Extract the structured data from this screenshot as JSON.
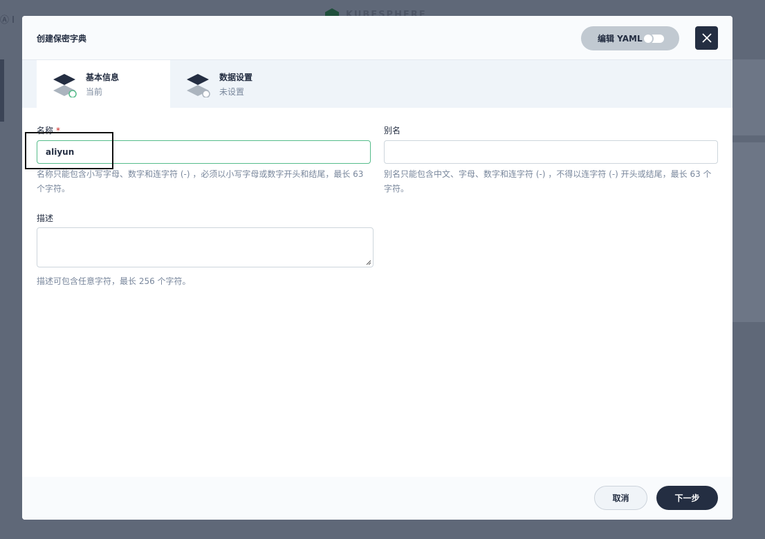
{
  "background": {
    "topleft_text": "Ⓐ I",
    "logo_text": "KUBESPHERE"
  },
  "modal": {
    "title": "创建保密字典",
    "edit_yaml_label": "编辑 YAML",
    "close_icon": "close-icon"
  },
  "steps": [
    {
      "title": "基本信息",
      "status": "当前"
    },
    {
      "title": "数据设置",
      "status": "未设置"
    }
  ],
  "form": {
    "name": {
      "label": "名称",
      "required_mark": "*",
      "value": "aliyun",
      "hint": "名称只能包含小写字母、数字和连字符 (-) ，必须以小写字母或数字开头和结尾，最长 63 个字符。"
    },
    "alias": {
      "label": "别名",
      "value": "",
      "hint": "别名只能包含中文、字母、数字和连字符 (-) ，不得以连字符 (-) 开头或结尾，最长 63 个字符。"
    },
    "description": {
      "label": "描述",
      "value": "",
      "hint": "描述可包含任意字符，最长 256 个字符。"
    }
  },
  "footer": {
    "cancel_label": "取消",
    "next_label": "下一步"
  },
  "colors": {
    "primary": "#242e42",
    "success": "#55bc8a",
    "required": "#ca2621",
    "muted": "#79879c"
  }
}
